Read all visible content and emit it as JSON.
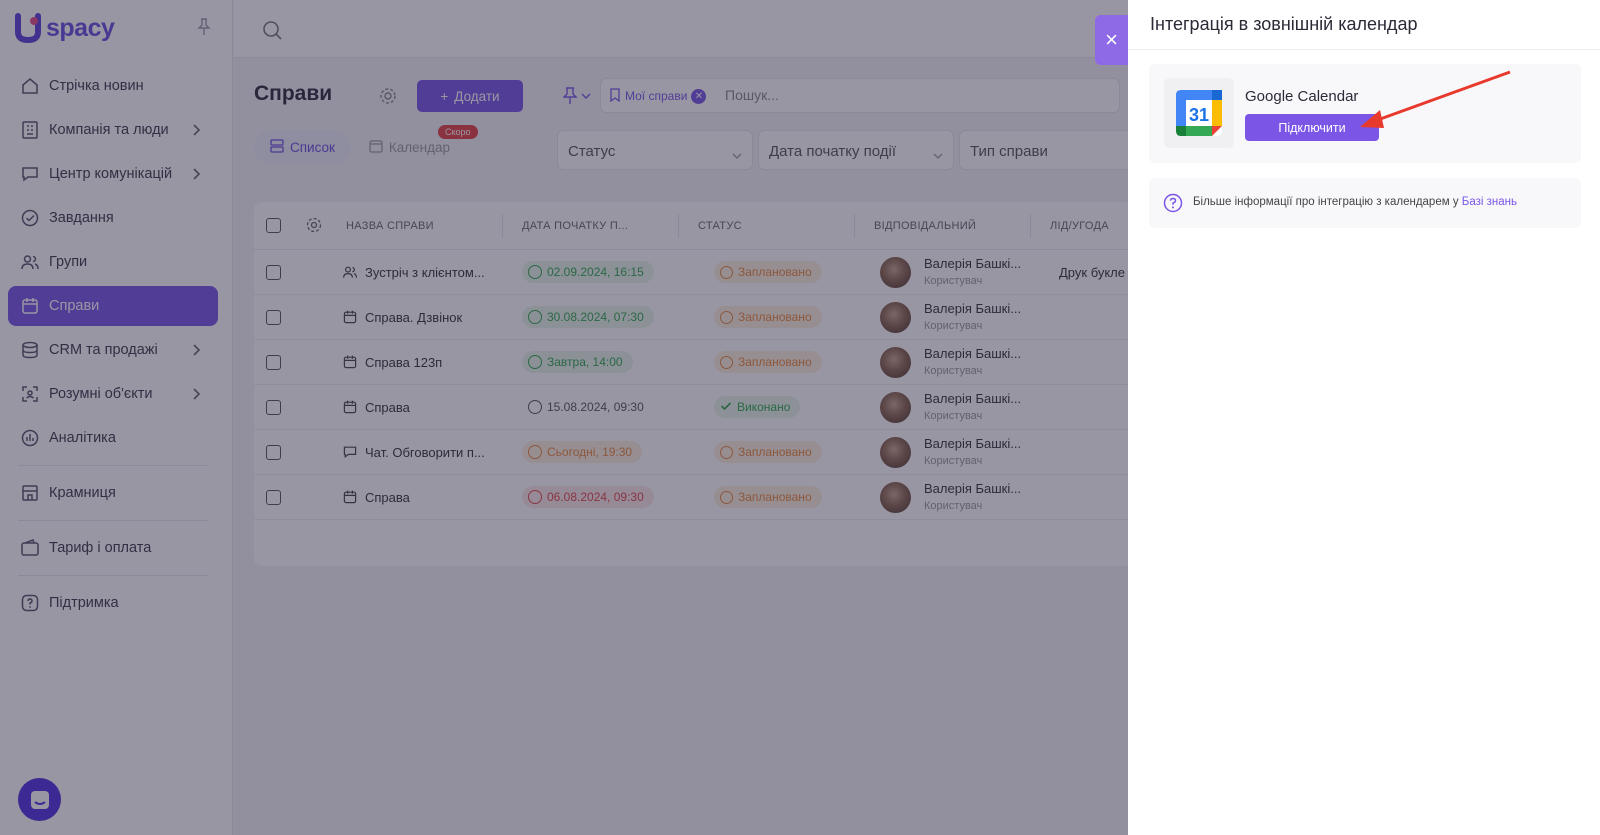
{
  "app": {
    "logo_text": "spacy"
  },
  "sidebar": {
    "items": [
      {
        "label": "Стрічка новин",
        "icon": "home-icon",
        "chevron": false
      },
      {
        "label": "Компанія та люди",
        "icon": "building-icon",
        "chevron": true
      },
      {
        "label": "Центр комунікацій",
        "icon": "chat-icon",
        "chevron": true
      },
      {
        "label": "Завдання",
        "icon": "check-circle-icon",
        "chevron": false
      },
      {
        "label": "Групи",
        "icon": "users-icon",
        "chevron": false
      },
      {
        "label": "Справи",
        "icon": "calendar-icon",
        "chevron": false,
        "active": true
      },
      {
        "label": "CRM та продажі",
        "icon": "database-icon",
        "chevron": true
      },
      {
        "label": "Розумні об'єкти",
        "icon": "scan-icon",
        "chevron": true
      },
      {
        "label": "Аналітика",
        "icon": "chart-icon",
        "chevron": false
      },
      {
        "label": "Крамниця",
        "icon": "store-icon",
        "chevron": false
      },
      {
        "label": "Тариф і оплата",
        "icon": "wallet-icon",
        "chevron": false
      },
      {
        "label": "Підтримка",
        "icon": "help-icon",
        "chevron": false
      }
    ]
  },
  "page": {
    "title": "Справи",
    "add_button": "Додати",
    "filter_chip": "Мої справи",
    "search_placeholder": "Пошук...",
    "tabs": [
      {
        "label": "Список",
        "active": true
      },
      {
        "label": "Календар",
        "active": false
      }
    ],
    "soon_badge": "Скоро",
    "filters": [
      "Статус",
      "Дата початку події",
      "Тип справи"
    ]
  },
  "table": {
    "headers": [
      "НАЗВА СПРАВИ",
      "ДАТА ПОЧАТКУ П...",
      "СТАТУС",
      "ВІДПОВІДАЛЬНИЙ",
      "ЛІД/УГОДА"
    ],
    "rows": [
      {
        "name": "Зустріч з клієнтом...",
        "type_icon": "users-icon",
        "date": "02.09.2024, 16:15",
        "date_tone": "green",
        "status": "Заплановано",
        "status_tone": "planned",
        "responsible": "Валерія Башкі...",
        "role": "Користувач",
        "lead": "Друк букле"
      },
      {
        "name": "Справа. Дзвінок",
        "type_icon": "calendar-icon",
        "date": "30.08.2024, 07:30",
        "date_tone": "green",
        "status": "Заплановано",
        "status_tone": "planned",
        "responsible": "Валерія Башкі...",
        "role": "Користувач",
        "lead": ""
      },
      {
        "name": "Справа 123п",
        "type_icon": "calendar-icon",
        "date": "Завтра, 14:00",
        "date_tone": "green",
        "status": "Заплановано",
        "status_tone": "planned",
        "responsible": "Валерія Башкі...",
        "role": "Користувач",
        "lead": ""
      },
      {
        "name": "Справа",
        "type_icon": "calendar-icon",
        "date": "15.08.2024, 09:30",
        "date_tone": "plain",
        "status": "Виконано",
        "status_tone": "done",
        "responsible": "Валерія Башкі...",
        "role": "Користувач",
        "lead": ""
      },
      {
        "name": "Чат. Обговорити п...",
        "type_icon": "chat-icon",
        "date": "Сьогодні, 19:30",
        "date_tone": "orange",
        "status": "Заплановано",
        "status_tone": "planned",
        "responsible": "Валерія Башкі...",
        "role": "Користувач",
        "lead": ""
      },
      {
        "name": "Справа",
        "type_icon": "calendar-icon",
        "date": "06.08.2024, 09:30",
        "date_tone": "red",
        "status": "Заплановано",
        "status_tone": "planned",
        "responsible": "Валерія Башкі...",
        "role": "Користувач",
        "lead": ""
      }
    ]
  },
  "drawer": {
    "title": "Інтеграція в зовнішній календар",
    "calendar": {
      "name": "Google Calendar",
      "logo_number": "31",
      "connect_label": "Підключити"
    },
    "info_text": "Більше інформації про інтеграцію з календарем у ",
    "info_link": "Базі знань"
  },
  "colors": {
    "accent": "#7a55e6",
    "overlay": "#28243e",
    "green": "#2ea84a",
    "orange": "#e8893a",
    "red": "#e04545",
    "arrow": "#e8392d"
  }
}
